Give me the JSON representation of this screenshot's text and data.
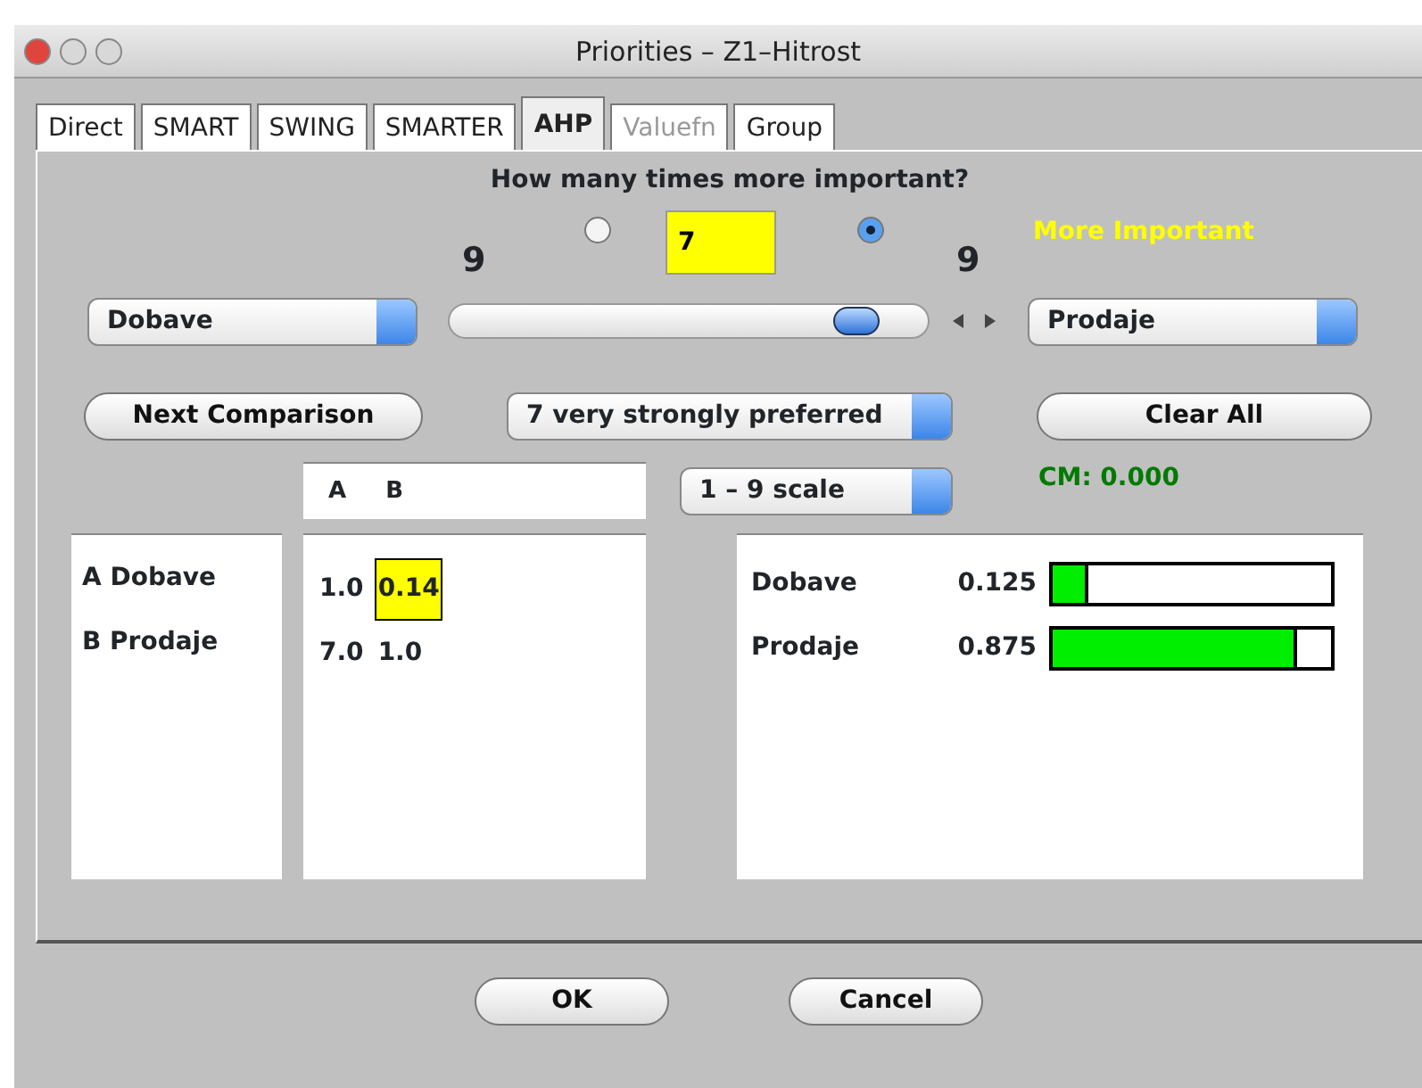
{
  "window": {
    "title": "Priorities – Z1–Hitrost"
  },
  "tabs": [
    {
      "label": "Direct",
      "selected": false,
      "disabled": false
    },
    {
      "label": "SMART",
      "selected": false,
      "disabled": false
    },
    {
      "label": "SWING",
      "selected": false,
      "disabled": false
    },
    {
      "label": "SMARTER",
      "selected": false,
      "disabled": false
    },
    {
      "label": "AHP",
      "selected": true,
      "disabled": false
    },
    {
      "label": "Valuefn",
      "selected": false,
      "disabled": true
    },
    {
      "label": "Group",
      "selected": false,
      "disabled": false
    }
  ],
  "question": "How many times more important?",
  "left_value": "9",
  "right_value": "9",
  "radios": [
    {
      "selected": false
    },
    {
      "selected": true
    }
  ],
  "intensity_field": {
    "value": "7"
  },
  "more_important": "More Important",
  "left_select": "Dobave",
  "slider": {
    "level": 0.85
  },
  "right_select": "Prodaje",
  "next_button": "Next Comparison",
  "preference_select": "7 very strongly preferred",
  "clear_button": "Clear All",
  "scale_select": "1 – 9 scale",
  "consistency": "CM: 0.000",
  "matrix": {
    "columns": [
      "A",
      "B"
    ],
    "row_labels": [
      "A Dobave",
      "B Prodaje"
    ],
    "rows": [
      [
        {
          "value": "1.0",
          "highlighted": false
        },
        {
          "value": "0.14",
          "highlighted": true
        }
      ],
      [
        {
          "value": "7.0",
          "highlighted": false
        },
        {
          "value": "1.0",
          "highlighted": false
        }
      ]
    ]
  },
  "weights": [
    {
      "name": "Dobave",
      "value": "0.125",
      "level": 0.125
    },
    {
      "name": "Prodaje",
      "value": "0.875",
      "level": 0.875
    }
  ],
  "buttons": [
    "OK",
    "Cancel"
  ]
}
